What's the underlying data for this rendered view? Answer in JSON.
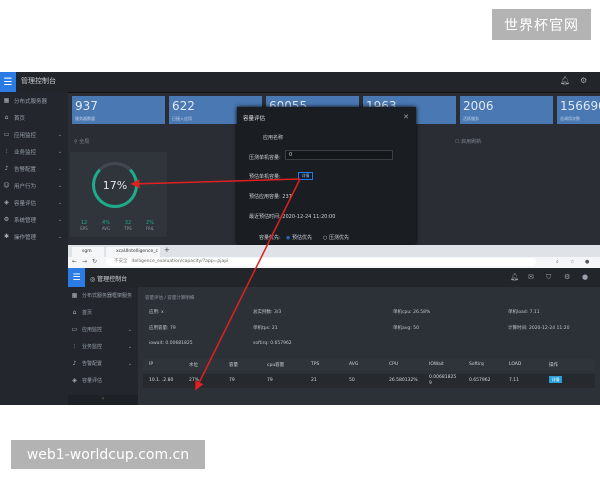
{
  "watermark_top": "世界杯官网",
  "watermark_bottom": "web1-worldcup.com.cn",
  "app": {
    "title": "管理控制台",
    "sidebar": [
      {
        "label": "分布式服务器",
        "icon": "grid-icon"
      },
      {
        "label": "首页",
        "icon": "home-icon"
      },
      {
        "label": "应用监控",
        "icon": "monitor-icon"
      },
      {
        "label": "业务监控",
        "icon": "sliders-icon"
      },
      {
        "label": "告警配置",
        "icon": "bell-icon"
      },
      {
        "label": "用户行为",
        "icon": "user-icon"
      },
      {
        "label": "容量评估",
        "icon": "cube-icon"
      },
      {
        "label": "系统管理",
        "icon": "gear-icon"
      },
      {
        "label": "操作管理",
        "icon": "settings-icon"
      }
    ],
    "cards": [
      {
        "value": "937",
        "label": "服务器数量"
      },
      {
        "value": "622",
        "label": "已接入应用"
      },
      {
        "value": "60055",
        "label": ""
      },
      {
        "value": "1963",
        "label": ""
      },
      {
        "value": "2006",
        "label": "活跃服务"
      },
      {
        "value": "156690",
        "label": "总调用次数"
      }
    ],
    "location_label": "全局",
    "checkbox_label": "启用刷新",
    "gauge": {
      "percent_text": "17%",
      "percent": 0.17,
      "stats": [
        {
          "value": "12",
          "label": "EPS"
        },
        {
          "value": "4%",
          "label": "AVG"
        },
        {
          "value": "32",
          "label": "TPS"
        },
        {
          "value": "2%",
          "label": "FAIL"
        }
      ]
    }
  },
  "modal": {
    "title": "容量评估",
    "rows": [
      {
        "label": "应用名称",
        "value": ""
      },
      {
        "label": "压测单机容量:",
        "value": "0"
      },
      {
        "label": "预估单机容量:",
        "value": ""
      },
      {
        "label": "预估应用容量:",
        "value": "237"
      },
      {
        "label": "最近预估时间:",
        "value": "2020-12-24 11:20:00"
      },
      {
        "label": "容量优先:",
        "value": ""
      }
    ],
    "detail_button": "详情",
    "radio_1": "预估优先",
    "radio_2": "压测优先"
  },
  "browser": {
    "tabs": [
      "sgm",
      "xcaUIntelligence_c"
    ],
    "new_tab": "+",
    "url_prefix": "不安全",
    "url": "itelligence_evaluation/capacity/?app=pjapi",
    "app_title": "管理控制台",
    "sidebar": [
      {
        "label": "分布式服务器框架服务",
        "icon": "grid-icon"
      },
      {
        "label": "首页",
        "icon": "home-icon"
      },
      {
        "label": "应用监控",
        "icon": "monitor-icon"
      },
      {
        "label": "业务监控",
        "icon": "sliders-icon"
      },
      {
        "label": "告警配置",
        "icon": "bell-icon"
      },
      {
        "label": "容量评估",
        "icon": "cube-icon"
      }
    ],
    "breadcrumb": "容量评估  /  容量计算明细",
    "info": [
      {
        "label": "应用:",
        "value": "x"
      },
      {
        "label": "总实例数:",
        "value": "3/3"
      },
      {
        "label": "单机cpu:",
        "value": "26.58%"
      },
      {
        "label": "单机load:",
        "value": "7.11"
      },
      {
        "label": "应用容量:",
        "value": "79"
      },
      {
        "label": "单机tps:",
        "value": "21"
      },
      {
        "label": "单机avg:",
        "value": "50"
      },
      {
        "label": "计算时间:",
        "value": "2020-12-24 11:20"
      },
      {
        "label": "iowait:",
        "value": "0.00681825"
      },
      {
        "label": "softirq:",
        "value": "0.657962"
      }
    ],
    "table": {
      "headers": [
        "IP",
        "水位",
        "容量",
        "cpu容量",
        "TPS",
        "AVG",
        "CPU",
        "IOWait",
        "Softirq",
        "LOAD",
        "操作"
      ],
      "row": [
        "10.1.  .2.80",
        "27%",
        "79",
        "79",
        "21",
        "50",
        "26.580132%",
        "0.00681825 9",
        "0.657962",
        "7.11",
        "详情"
      ]
    }
  }
}
